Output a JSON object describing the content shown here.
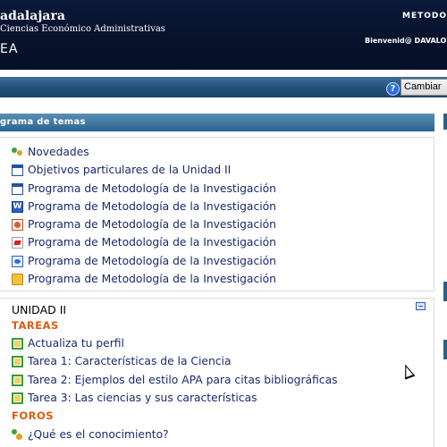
{
  "header": {
    "title": "adalajara",
    "subtitle": "Ciencias Económico Administrativas",
    "short_name": "EA",
    "right_title": "METODOL",
    "welcome": "Bienvenid@ DAVALO"
  },
  "navbar": {
    "help_icon": "question-circle-icon",
    "change_button": "Cambiar"
  },
  "block": {
    "title": "grama de temas"
  },
  "section0": {
    "items": [
      {
        "label": "Novedades",
        "icon": "forum-users-icon"
      },
      {
        "label": "Objetivos particulares de la Unidad II",
        "icon": "window-icon"
      },
      {
        "label": "Programa de Metodología de la Investigación",
        "icon": "window-icon"
      },
      {
        "label": "Programa de Metodología de la Investigación",
        "icon": "word-doc-icon"
      },
      {
        "label": "Programa de Metodología de la Investigación",
        "icon": "powerpoint-icon"
      },
      {
        "label": "Programa de Metodología de la Investigación",
        "icon": "pdf-icon"
      },
      {
        "label": "Programa de Metodología de la Investigación",
        "icon": "web-link-icon"
      },
      {
        "label": "Programa de Metodología de la Investigación",
        "icon": "folder-icon"
      }
    ]
  },
  "unit": {
    "title": "UNIDAD II",
    "tasks_label": "TAREAS",
    "tasks": [
      {
        "label": "Actualiza tu perfil",
        "icon": "assignment-icon"
      },
      {
        "label": "Tarea 1: Características de la Ciencia",
        "icon": "assignment-icon"
      },
      {
        "label": "Tarea 2: Ejemplos del estilo APA para citas bibliográficas",
        "icon": "assignment-icon"
      },
      {
        "label": "Tarea 3: Las ciencias y sus características",
        "icon": "assignment-icon"
      }
    ],
    "forums_label": "FOROS",
    "forums": [
      {
        "label": "¿Qué es el conocimiento?",
        "icon": "forum-icon"
      }
    ]
  }
}
